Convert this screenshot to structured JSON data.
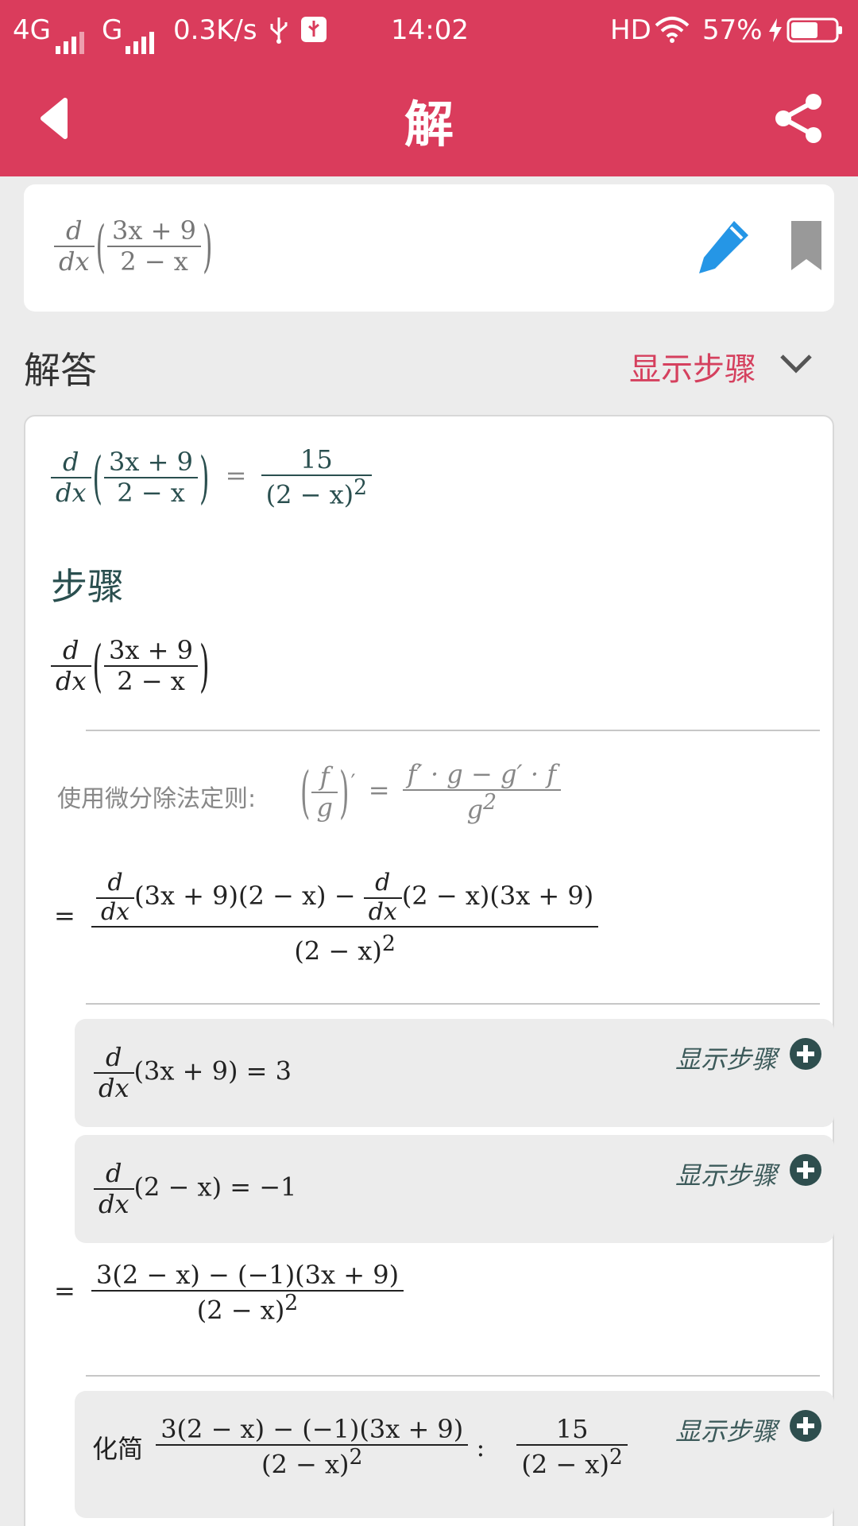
{
  "status": {
    "net1": "4G",
    "net2": "G",
    "speed": "0.3K/s",
    "time": "14:02",
    "hd": "HD",
    "battery": "57%"
  },
  "header": {
    "title": "解"
  },
  "input": {
    "d": "d",
    "dx": "dx",
    "num": "3x + 9",
    "den": "2 − x"
  },
  "solution": {
    "title": "解答",
    "show_steps": "显示步骤",
    "result": {
      "lhs_num": "3x + 9",
      "lhs_den": "2 − x",
      "rhs_num": "15",
      "rhs_den": "(2 − x)",
      "rhs_exp": "2"
    },
    "steps_title": "步骤",
    "step_expr": {
      "num": "3x + 9",
      "den": "2 − x"
    },
    "rule": {
      "label": "使用微分除法定则:",
      "f": "f",
      "g": "g",
      "prime": "′",
      "rhs_num": "f′ · g − g′ · f",
      "rhs_den": "g",
      "rhs_exp": "2"
    },
    "quotient": {
      "num_a": "(3x + 9)(2 − x) −",
      "num_b": "(2 − x)(3x + 9)",
      "den": "(2 − x)",
      "den_exp": "2"
    },
    "substeps": [
      {
        "expr": "(3x + 9) = 3",
        "show": "显示步骤"
      },
      {
        "expr": "(2 − x) =  −1",
        "show": "显示步骤"
      }
    ],
    "combined": {
      "num": "3(2 − x) − (−1)(3x + 9)",
      "den": "(2 − x)",
      "den_exp": "2"
    },
    "simplify": {
      "label": "化简",
      "num": "3(2 − x) − (−1)(3x + 9)",
      "den": "(2 − x)",
      "den_exp": "2",
      "colon": ":",
      "res_num": "15",
      "res_den": "(2 − x)",
      "res_exp": "2",
      "show": "显示步骤"
    }
  }
}
